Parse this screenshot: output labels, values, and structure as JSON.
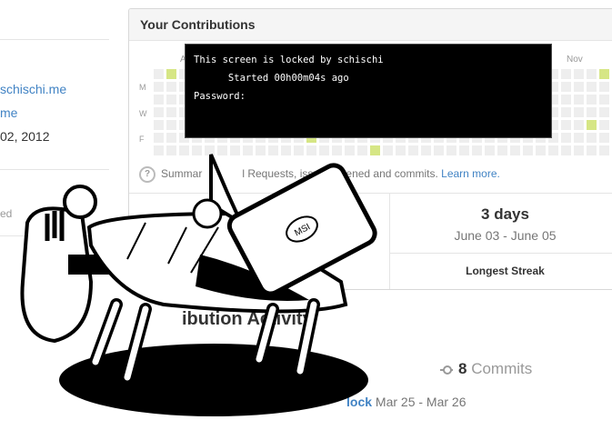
{
  "profile": {
    "link_primary": "schischi.me",
    "link_secondary": "me",
    "joined": "02, 2012",
    "muted_label": "ed"
  },
  "contributions": {
    "title": "Your Contributions",
    "visible_months": [
      "A",
      "Nov"
    ],
    "day_labels": [
      "M",
      "W",
      "F"
    ],
    "legend_text": "Summary of Pull Requests, issues opened and commits.",
    "legend_visible_prefix": "Summar",
    "legend_visible_suffix": "l Requests, issues opened and commits.",
    "learn_more": "Learn more."
  },
  "streak": {
    "value": "3 days",
    "range": "June 03 - June 05",
    "label": "Longest Streak"
  },
  "lock_screen": {
    "line1": "This screen is locked by schischi",
    "line2": "      Started 00h00m04s ago",
    "line3": "Password:"
  },
  "activity": {
    "title_fragment": "ibution Activity",
    "commits_count": "8",
    "commits_label": "Commits",
    "repo_fragment": "lock",
    "date_range": "Mar 25 - Mar 26"
  },
  "icons": {
    "help": "question-circle-icon",
    "commit": "commit-icon",
    "mascot": "msi-laptop-table-mascot"
  },
  "colors": {
    "link": "#4183c4",
    "cell_empty": "#eeeeee",
    "cell_light": "#d6e685",
    "lock_bg": "#000000"
  }
}
